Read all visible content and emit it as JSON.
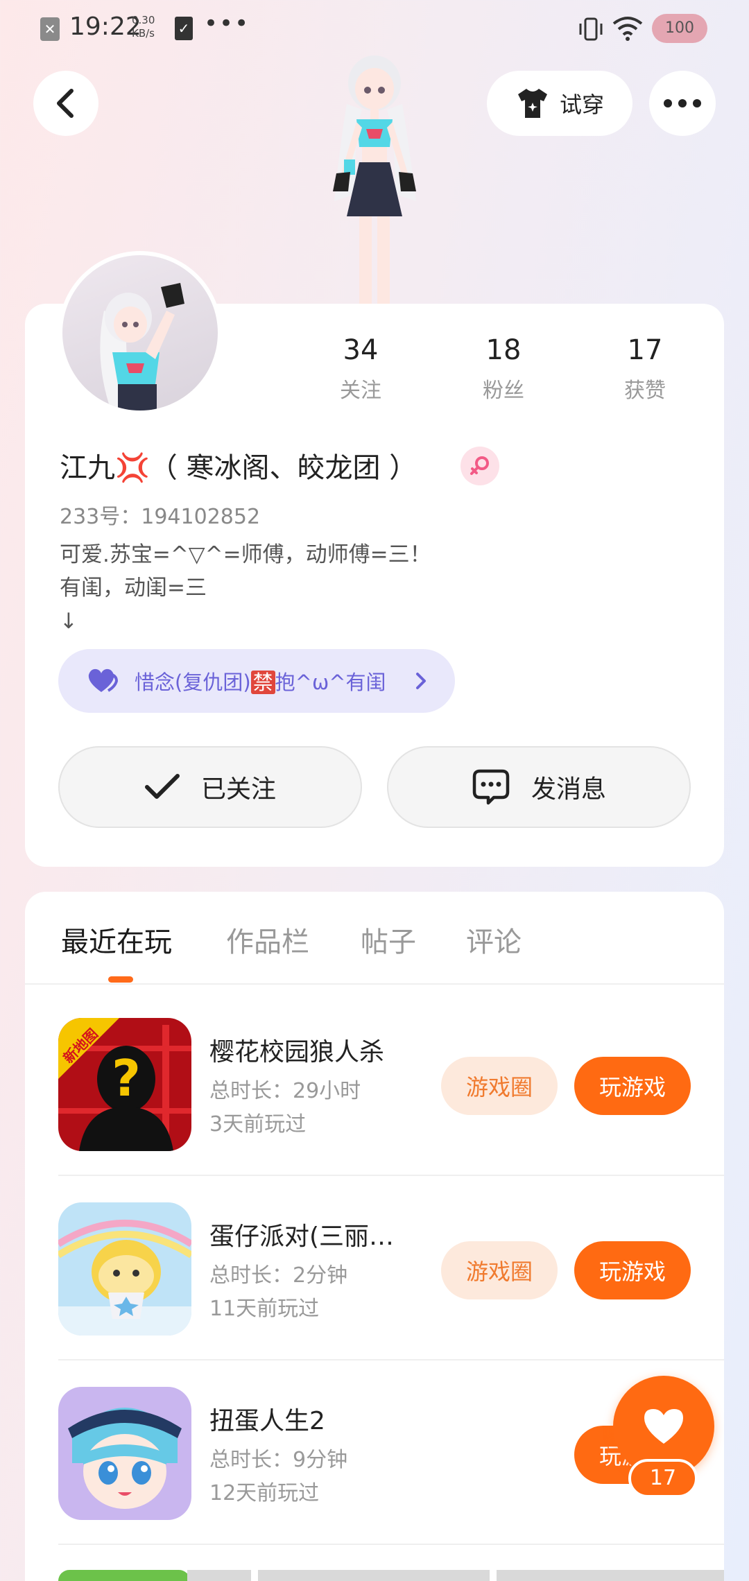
{
  "status_bar": {
    "time": "19:22",
    "speed_value": "0.30",
    "speed_unit": "KB/s",
    "battery": "100"
  },
  "top_bar": {
    "try_on_label": "试穿"
  },
  "profile": {
    "stats": [
      {
        "count": "34",
        "label": "关注"
      },
      {
        "count": "18",
        "label": "粉丝"
      },
      {
        "count": "17",
        "label": "获赞"
      }
    ],
    "name": "江九💢（ 寒冰阁、皎龙团 ）",
    "uid": "233号：194102852",
    "bio": "可爱.苏宝=^▽^=师傅，动师傅=三！\n有闺，动闺=三\n↓",
    "club": {
      "text_before": "惜念(复仇团)",
      "badge": "禁",
      "text_after": "抱^ω^有闺"
    },
    "follow_label": "已关注",
    "message_label": "发消息"
  },
  "tabs": [
    {
      "label": "最近在玩",
      "active": true
    },
    {
      "label": "作品栏",
      "active": false
    },
    {
      "label": "帖子",
      "active": false
    },
    {
      "label": "评论",
      "active": false
    }
  ],
  "games": [
    {
      "title": "樱花校园狼人杀",
      "duration": "总时长：29小时",
      "last_played": "3天前玩过",
      "badge": "新地图",
      "circle_label": "游戏圈",
      "play_label": "玩游戏"
    },
    {
      "title": "蛋仔派对(三丽…",
      "duration": "总时长：2分钟",
      "last_played": "11天前玩过",
      "circle_label": "游戏圈",
      "play_label": "玩游戏"
    },
    {
      "title": "扭蛋人生2",
      "duration": "总时长：9分钟",
      "last_played": "12天前玩过",
      "play_label": "玩游戏"
    }
  ],
  "like_fab": {
    "count": "17"
  },
  "colors": {
    "accent": "#ff6a12",
    "club_bg": "#e9e8fb",
    "club_text": "#6a62d8"
  },
  "icons": {
    "back": "chevron-left-icon",
    "try_on": "tshirt-icon",
    "more": "more-icon",
    "gender": "female-icon",
    "club": "heart-icon",
    "follow": "check-icon",
    "message": "chat-bubble-icon",
    "like": "heart-icon"
  }
}
